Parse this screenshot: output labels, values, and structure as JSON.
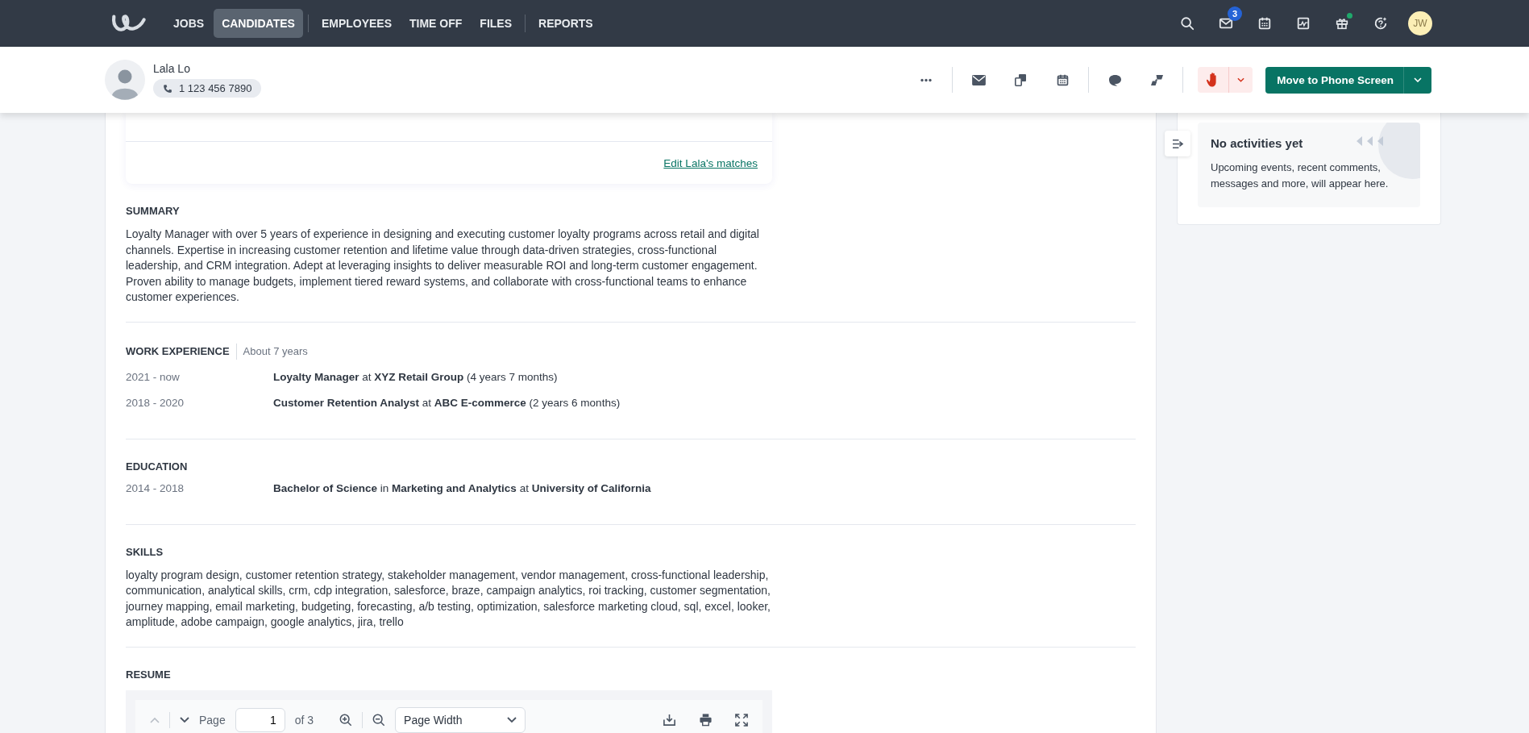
{
  "nav": {
    "items": [
      {
        "label": "JOBS",
        "selected": false,
        "divider_before": false
      },
      {
        "label": "CANDIDATES",
        "selected": true,
        "divider_before": false
      },
      {
        "label": "EMPLOYEES",
        "selected": false,
        "divider_before": true
      },
      {
        "label": "TIME OFF",
        "selected": false,
        "divider_before": false
      },
      {
        "label": "FILES",
        "selected": false,
        "divider_before": false
      },
      {
        "label": "REPORTS",
        "selected": false,
        "divider_before": true
      }
    ],
    "tools": [
      {
        "kind": "search"
      },
      {
        "kind": "mail",
        "badge": "3"
      },
      {
        "kind": "calendar"
      },
      {
        "kind": "chart"
      },
      {
        "kind": "gift",
        "dot": true
      },
      {
        "kind": "help"
      }
    ],
    "avatar": "JW"
  },
  "candidate": {
    "name": "Lala Lo",
    "phone": "1 123 456 7890",
    "actions": [
      {
        "kind": "more"
      },
      {
        "kind": "sep"
      },
      {
        "kind": "mail"
      },
      {
        "kind": "copy"
      },
      {
        "kind": "calendar"
      },
      {
        "kind": "sep"
      },
      {
        "kind": "comment"
      },
      {
        "kind": "link"
      },
      {
        "kind": "sep"
      }
    ],
    "primary_action": "Move to Phone Screen"
  },
  "matches": {
    "link": "Edit Lala's matches"
  },
  "summary": {
    "heading": "SUMMARY",
    "text": "Loyalty Manager with over 5 years of experience in designing and executing customer loyalty programs across retail and digital channels. Expertise in increasing customer retention and lifetime value through data-driven strategies, cross-functional leadership, and CRM integration. Adept at leveraging insights to deliver measurable ROI and long-term customer engagement. Proven ability to manage budgets, implement tiered reward systems, and collaborate with cross-functional teams to enhance customer experiences."
  },
  "work_experience": {
    "heading": "WORK EXPERIENCE",
    "total": "About 7 years",
    "rows": [
      {
        "period": "2021 - now",
        "text": "**Loyalty Manager** at **XYZ Retail Group** (4 years 7 months)"
      },
      {
        "period": "2018 - 2020",
        "text": "**Customer Retention Analyst** at **ABC E-commerce** (2 years 6 months)"
      }
    ]
  },
  "education": {
    "heading": "EDUCATION",
    "rows": [
      {
        "period": "2014 - 2018",
        "text": "**Bachelor of Science** in **Marketing and Analytics** at **University of California**"
      }
    ]
  },
  "skills": {
    "heading": "SKILLS",
    "text": "loyalty program design, customer retention strategy, stakeholder management, vendor management, cross-functional leadership, communication, analytical skills, crm, cdp integration, salesforce, braze, campaign analytics, roi tracking, customer segmentation, journey mapping, email marketing, budgeting, forecasting, a/b testing, optimization, salesforce marketing cloud, sql, excel, looker, amplitude, adobe campaign, google analytics, jira, trello"
  },
  "resume": {
    "heading": "RESUME",
    "page_label": "Page",
    "page": "1",
    "of": "of 3",
    "zoom": "Page Width"
  },
  "activity": {
    "title": "No activities yet",
    "text": "Upcoming events, recent comments, messages and more, will appear here."
  }
}
